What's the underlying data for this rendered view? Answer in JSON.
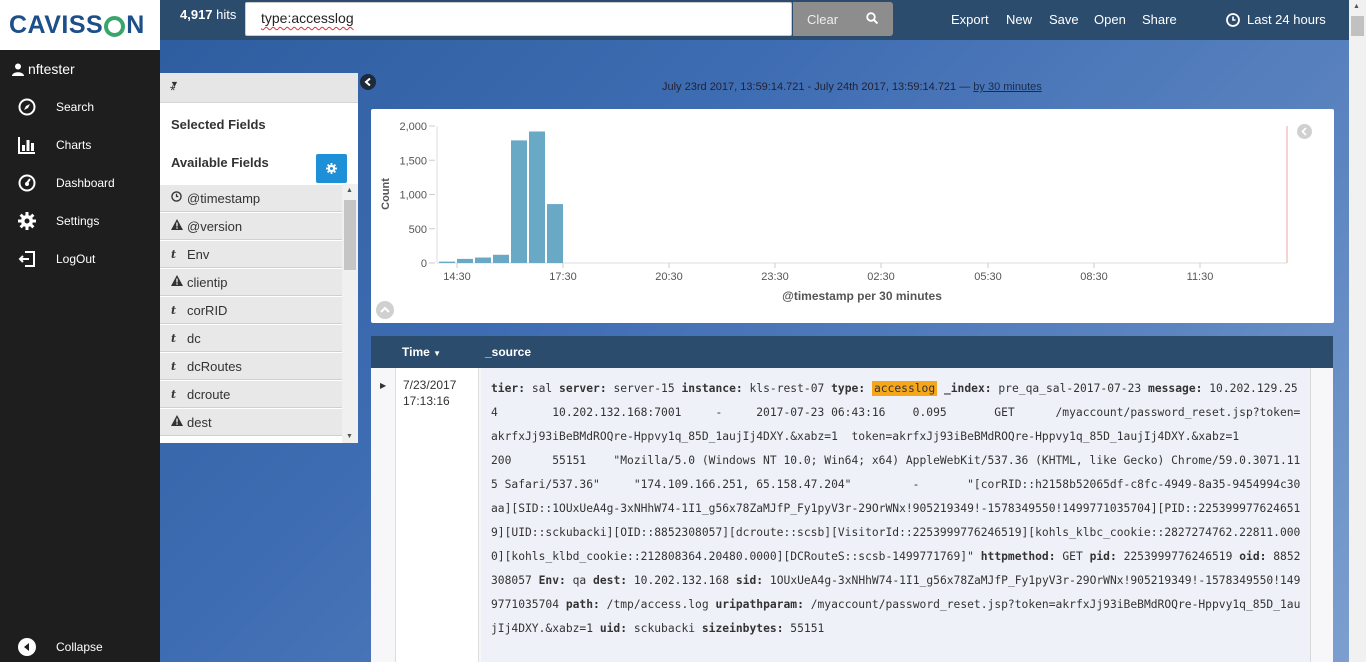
{
  "brand": {
    "logo_text_left": "CAVISS",
    "logo_text_right": "N"
  },
  "user": {
    "name": "nftester"
  },
  "nav": {
    "items": [
      {
        "label": "Search",
        "icon": "compass-icon"
      },
      {
        "label": "Charts",
        "icon": "bar-chart-icon"
      },
      {
        "label": "Dashboard",
        "icon": "dashboard-icon"
      },
      {
        "label": "Settings",
        "icon": "gear-icon"
      },
      {
        "label": "LogOut",
        "icon": "logout-icon"
      }
    ],
    "collapse_label": "Collapse"
  },
  "topbar": {
    "hits_count": "4,917",
    "hits_label": "hits",
    "query": "type:accesslog",
    "clear_label": "Clear",
    "links": [
      "Export",
      "New",
      "Save",
      "Open",
      "Share"
    ],
    "time_label": "Last 24 hours"
  },
  "sidebar": {
    "index_pattern": "*",
    "selected_title": "Selected Fields",
    "available_title": "Available Fields",
    "fields": [
      {
        "type": "clock",
        "name": "@timestamp"
      },
      {
        "type": "warn",
        "name": "@version"
      },
      {
        "type": "t",
        "name": "Env"
      },
      {
        "type": "warn",
        "name": "clientip"
      },
      {
        "type": "t",
        "name": "corRID"
      },
      {
        "type": "t",
        "name": "dc"
      },
      {
        "type": "t",
        "name": "dcRoutes"
      },
      {
        "type": "t",
        "name": "dcroute"
      },
      {
        "type": "warn",
        "name": "dest"
      }
    ]
  },
  "range": {
    "text": "July 23rd 2017, 13:59:14.721 - July 24th 2017, 13:59:14.721 — ",
    "interval_link": "by 30 minutes"
  },
  "chart_data": {
    "type": "bar",
    "ylabel": "Count",
    "xlabel": "@timestamp per 30 minutes",
    "ylim": [
      0,
      2000
    ],
    "yticks": [
      "0",
      "500",
      "1,000",
      "1,500",
      "2,000"
    ],
    "xticks": [
      "14:30",
      "17:30",
      "20:30",
      "23:30",
      "02:30",
      "05:30",
      "08:30",
      "11:30"
    ],
    "values": [
      20,
      60,
      80,
      120,
      1790,
      1920,
      860
    ],
    "color": "#6aa9c5",
    "now_marker_color": "#e8a7a2"
  },
  "table": {
    "col_time": "Time",
    "col_source": "_source",
    "row": {
      "date": "7/23/2017",
      "time": "17:13:16",
      "source_segments": [
        {
          "k": "tier:",
          "v": " sal  "
        },
        {
          "k": "server:",
          "v": " server-15  "
        },
        {
          "k": "instance:",
          "v": " kls-rest-07  "
        },
        {
          "k": "type:",
          "v": " "
        },
        {
          "hl": "accesslog"
        },
        {
          "k": "  _index:",
          "v": " pre_qa_sal-2017-07-23"
        }
      ],
      "message_key": "message:",
      "message_value": " 10.202.129.254        10.202.132.168:7001     -     2017-07-23 06:43:16    0.095       GET      /myaccount/password_reset.jsp?token=akrfxJj93iBeBMdROQre-Hppvy1q_85D_1aujIj4DXY.&xabz=1  token=akrfxJj93iBeBMdROQre-Hppvy1q_85D_1aujIj4DXY.&xabz=1         200      55151    \"Mozilla/5.0 (Windows NT 10.0; Win64; x64) AppleWebKit/537.36 (KHTML, like Gecko) Chrome/59.0.3071.115 Safari/537.36\"     \"174.109.166.251, 65.158.47.204\"         -       \"[corRID::h2158b52065df-c8fc-4949-8a35-9454994c30aa][SID::1OUxUeA4g-3xNHhW74-1I1_g56x78ZaMJfP_Fy1pyV3r-29OrWNx!905219349!-1578349550!1499771035704][PID::2253999776246519][UID::sckubacki][OID::8852308057][dcroute::scsb][VisitorId::2253999776246519][kohls_klbc_cookie::2827274762.22811.0000][kohls_klbd_cookie::212808364.20480.0000][DCRouteS::scsb-1499771769]\"",
      "tail_segments": [
        {
          "k": "httpmethod:",
          "v": " GET  "
        },
        {
          "k": "pid:",
          "v": " 2253999776246519  "
        },
        {
          "k": "oid:",
          "v": " 8852308057  "
        },
        {
          "k": "Env:",
          "v": " qa  "
        },
        {
          "k": "dest:",
          "v": " 10.202.132.168  "
        },
        {
          "k": "sid:",
          "v": " 1OUxUeA4g-3xNHhW74-1I1_g56x78ZaMJfP_Fy1pyV3r-29OrWNx!905219349!-1578349550!1499771035704  "
        },
        {
          "k": "path:",
          "v": " /tmp/access.log  "
        },
        {
          "k": "uripathparam:",
          "v": " /myaccount/password_reset.jsp?token=akrfxJj93iBeBMdROQre-Hppvy1q_85D_1aujIj4DXY.&xabz=1  "
        },
        {
          "k": "uid:",
          "v": " sckubacki  "
        },
        {
          "k": "sizeinbytes:",
          "v": " 55151"
        }
      ]
    }
  }
}
